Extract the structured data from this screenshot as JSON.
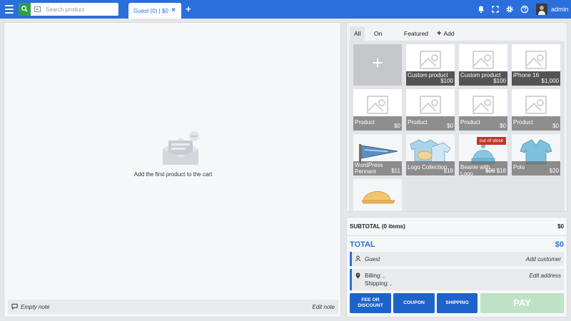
{
  "topbar": {
    "search_placeholder": "Search product",
    "tab_label": "Guest (0) | $0",
    "tab_close": "×",
    "tab_add": "+",
    "icons": [
      "hamburger-icon",
      "search-icon",
      "barcode-icon",
      "bell-icon",
      "fullscreen-icon",
      "gear-icon",
      "help-icon"
    ],
    "admin_name": "admin"
  },
  "cart": {
    "empty_text": "Add the first product to the cart",
    "note_text": "Empty note",
    "edit_note": "Edit note"
  },
  "products": {
    "tabs": [
      {
        "label": "All",
        "active": true
      },
      {
        "label": "On sale",
        "active": false
      },
      {
        "label": "Featured",
        "active": false
      }
    ],
    "add_product": "Add product",
    "add_plus": "+",
    "items": [
      {
        "name": "Custom product",
        "price": "$100"
      },
      {
        "name": "Custom product",
        "price": "$100"
      },
      {
        "name": "iPhone 16",
        "price": "$1,000"
      },
      {
        "name": "Product",
        "price": "$0"
      },
      {
        "name": "Product",
        "price": "$0"
      },
      {
        "name": "Product",
        "price": "$0"
      },
      {
        "name": "Product",
        "price": "$0"
      },
      {
        "name": "WordPress Pennant",
        "price": "$11"
      },
      {
        "name": "Logo Collection",
        "price": "$18"
      },
      {
        "name": "Beanie with Logo",
        "old_price": "$20",
        "price": "$18",
        "badge": "out of stock"
      },
      {
        "name": "Polo",
        "price": "$20"
      }
    ]
  },
  "checkout": {
    "subtotal_label": "SUBTOTAL (0 items)",
    "subtotal_value": "$0",
    "total_label": "TOTAL",
    "total_value": "$0",
    "guest_label": "Guest",
    "add_customer": "Add customer",
    "billing": "Billing: ,",
    "shipping": "Shipping: ,",
    "edit_address": "Edit address",
    "buttons": {
      "fee_line1": "FEE OR",
      "fee_line2": "DISCOUNT",
      "coupon": "COUPON",
      "shipping": "SHIPPING",
      "pay": "PAY"
    }
  },
  "colors": {
    "primary": "#2a6fdb",
    "search_green": "#2ea043",
    "button_blue": "#1e63c9",
    "pay_disabled": "#bfe2c6",
    "out_of_stock": "#c0392b"
  }
}
